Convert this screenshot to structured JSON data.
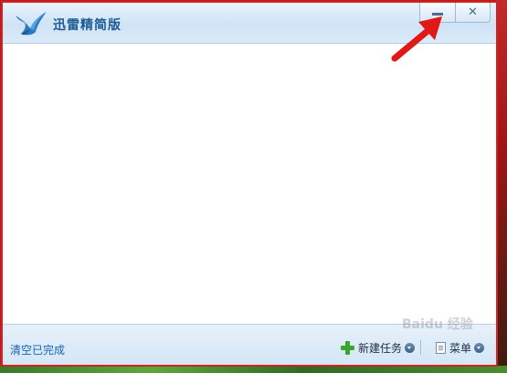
{
  "window": {
    "title": "迅雷精简版",
    "minimize_label": "",
    "close_label": "✕"
  },
  "bottombar": {
    "clear_completed": "清空已完成",
    "new_task": "新建任务",
    "menu": "菜单"
  },
  "icons": {
    "logo": "bird-logo-icon",
    "minimize": "minimize-icon",
    "close": "close-icon",
    "new_task": "plus-icon",
    "menu": "document-icon",
    "dropdown": "chevron-down-icon",
    "annotation": "red-arrow-icon"
  },
  "colors": {
    "accent": "#1d5b95",
    "window_border": "#d42222",
    "annotation_arrow": "#e01818",
    "plus_green": "#3aa62c"
  },
  "watermark": "Baidu 经验"
}
